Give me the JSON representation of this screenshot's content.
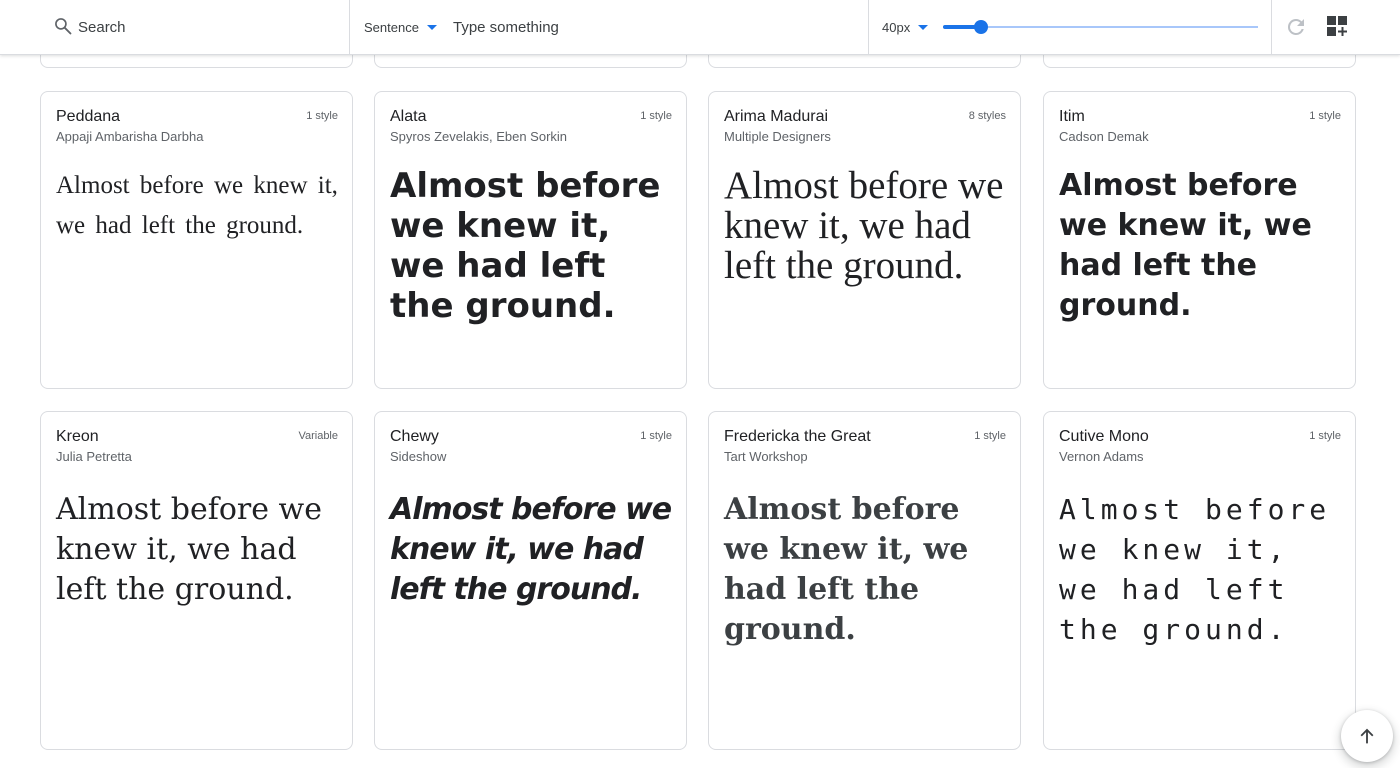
{
  "toolbar": {
    "search": {
      "placeholder": "Search"
    },
    "preview": {
      "mode": "Sentence",
      "placeholder": "Type something"
    },
    "size": {
      "label": "40px",
      "slider_fraction": 0.12
    },
    "icons": {
      "search": "search-icon",
      "reset": "refresh-icon",
      "grid": "grid-add-icon",
      "scroll_top": "arrow-up-icon"
    },
    "accent_color": "#1a73e8"
  },
  "cards": [
    {
      "name": "Peddana",
      "designer": "Appaji Ambarisha Darbha",
      "styles": "1 style",
      "sample": "Almost before we knew it, we had left the ground."
    },
    {
      "name": "Alata",
      "designer": "Spyros Zevelakis, Eben Sorkin",
      "styles": "1 style",
      "sample": "Almost before we knew it, we had left the ground."
    },
    {
      "name": "Arima Madurai",
      "designer": "Multiple Designers",
      "styles": "8 styles",
      "sample": "Almost before we knew it, we had left the ground."
    },
    {
      "name": "Itim",
      "designer": "Cadson Demak",
      "styles": "1 style",
      "sample": "Almost before we knew it, we had left the ground."
    },
    {
      "name": "Kreon",
      "designer": "Julia Petretta",
      "styles": "Variable",
      "sample": "Almost before we knew it, we had left the ground."
    },
    {
      "name": "Chewy",
      "designer": "Sideshow",
      "styles": "1 style",
      "sample": "Almost before we knew it, we had left the ground."
    },
    {
      "name": "Fredericka the Great",
      "designer": "Tart Workshop",
      "styles": "1 style",
      "sample": "Almost before we knew it, we had left the ground."
    },
    {
      "name": "Cutive Mono",
      "designer": "Vernon Adams",
      "styles": "1 style",
      "sample": "Almost before we knew it, we had left the ground."
    }
  ]
}
